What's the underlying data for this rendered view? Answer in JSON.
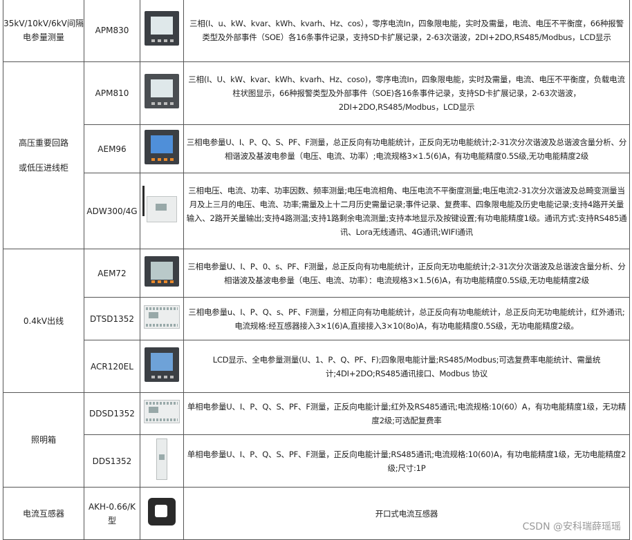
{
  "rows": [
    {
      "model": "APM830",
      "image": "APM830 panel meter",
      "desc": "三相(I、u、kW、kvar、kWh、kvarh、Hz、cos），零序电流In，四象限电能，实时及需量，电流、电压不平衡度，66种报警类型及外部事件（SOE）各16条事件记录，支持SD卡扩展记录，2-63次谐波，2DI+2DO,RS485/Modbus，LCD显示"
    },
    {
      "model": "APM810",
      "image": "APM810 panel meter",
      "desc": "三相(I、U、kW、kvar、kWh、kvarh、Hz、coso)，零序电流In，四象限电能，实时及需量，电流、电压不平衡度，负载电流柱状图显示，66种报警类型及外部事件（SOE)各16条事件记录，支持SD卡扩展记录，2-63次谐波，2DI+2DO,RS485/Modbus，LCD显示"
    },
    {
      "model": "AEM96",
      "image": "AEM96 panel meter",
      "desc": "三相电参量U、I、P、Q、S、PF、F测量，总正反向有功电能统计，正反向无功电能统计;2-31次分次谐波及总谐波含量分析、分相谐波及基波电参量（电压、电流、功率）;电流规格3×1.5(6)A，有功电能精度0.5S级,无功电能精度2级"
    },
    {
      "model": "ADW300/4G",
      "image": "ADW300 wireless meter",
      "desc": "三相电压、电流、功率、功率因数、频率测量;电压电流相角、电压电流不平衡度测量;电压电流2-31次分次谐波及总畸变测量当月及上三月的电压、电流、功率;需量及上十二月历史需量记录;事件记录、复费率、四象限电能及历史电能记录;支持4路开关量输入、2路开关量输出;支持4路测温;支持1路剩余电流测量;支持本地显示及按键设置;有功电能精度1级。通讯方式:支持RS485通讯、Lora无线通讯、4G通讯;WIFI通讯"
    },
    {
      "model": "AEM72",
      "image": "AEM72 panel meter",
      "desc": "三相电参量U、I、P、0、s、PF、F测量，总正反向有功电能统计，正反向无功电能统计;2-31次分次谐波及总谐波含量分析、分相谐波及基波电参量（电压、电流、功率）：电流规格3×1.5(6)A，有功电能精度0.5S级,无功电能精度2级"
    },
    {
      "model": "DTSD1352",
      "image": "DTSD1352 rail meter",
      "desc": "三相电参量u、I、P、Q、s、PF、F测量，分相正向有功电能统计，总正反向有功电能统计，总正反向无功电能统计，红外通讯;电流规格:经互感器接入3×1(6)A,直接接入3×10(8o)A，有功电能精度0.5S级，无功电能精度2级。"
    },
    {
      "model": "ACR120EL",
      "image": "ACR120EL panel meter",
      "desc": "LCD显示、全电参量测量(U、1、P、Q、PF、F);四象限电能计量;RS485/Modbus;可选复费率电能统计、需量统计;4DI+2DO;RS485通讯接口、Modbus 协议"
    },
    {
      "model": "DDSD1352",
      "image": "DDSD1352 rail meter",
      "desc": "单相电参量U、I、P、Q、S、PF、F测量，正反向电能计量;红外及RS485通讯;电流规格:10(60）A，有功电能精度1级，无功精度2级;可选配复费率"
    },
    {
      "model": "DDS1352",
      "image": "DDS1352 rail meter",
      "desc": "单相电参量U、I、P、Q、S、PF、F测量，正反向电能计量;RS485通讯;电流规格:10(60)A，有功电能精度1级，无功电能精度2级;尺寸:1P"
    },
    {
      "model": "AKH-0.66/K型",
      "image": "AKH split-core current transformer",
      "desc": "开口式电流互感器"
    }
  ],
  "categories": [
    {
      "label": "35kV/10kV/6kV间隔电参量测量"
    },
    {
      "label_line1": "高压重要回路",
      "label_line2": "或低压进线柜"
    },
    {
      "label": "0.4kV出线"
    },
    {
      "label": "照明箱"
    },
    {
      "label": "电流互感器"
    }
  ],
  "watermark": "CSDN @安科瑞薛瑶瑶"
}
